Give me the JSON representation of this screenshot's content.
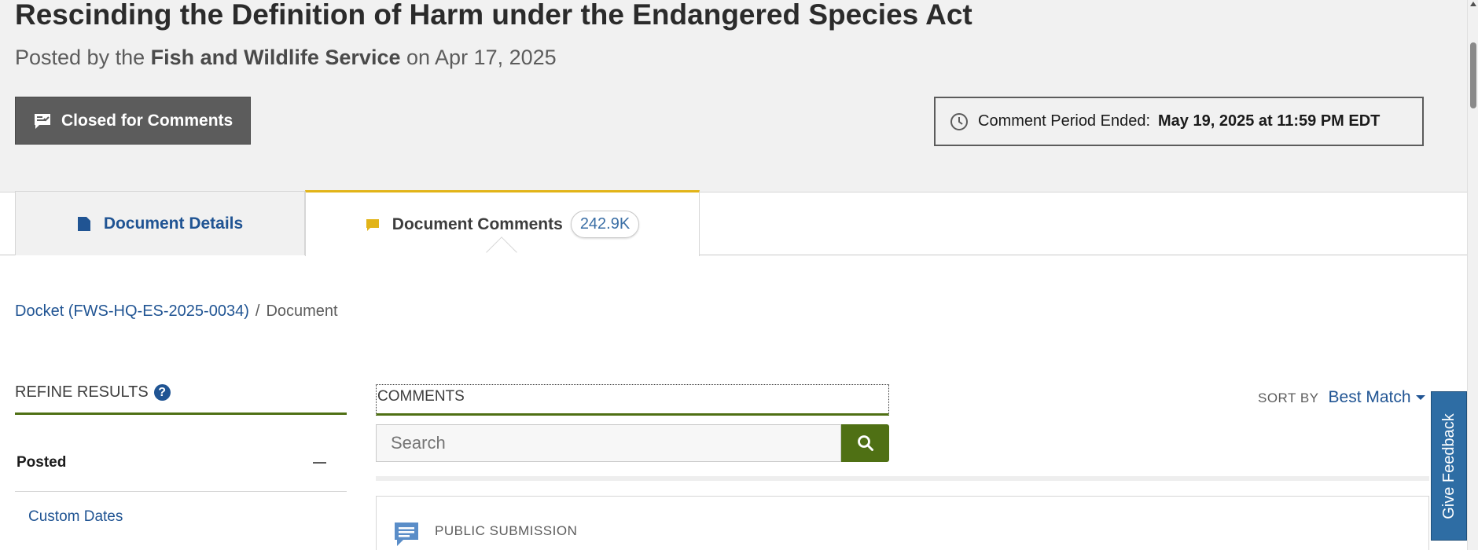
{
  "document": {
    "title": "Rescinding the Definition of Harm under the Endangered Species Act",
    "posted_prefix": "Posted by the",
    "agency": "Fish and Wildlife Service",
    "posted_on": "on Apr 17, 2025"
  },
  "status": {
    "closed_label": "Closed for Comments",
    "period_label": "Comment Period Ended:",
    "period_value": "May 19, 2025 at 11:59 PM EDT"
  },
  "tabs": [
    {
      "label": "Document Details"
    },
    {
      "label": "Document Comments",
      "count": "242.9K"
    }
  ],
  "breadcrumb": {
    "docket": "Docket (FWS-HQ-ES-2025-0034)",
    "separator": "/",
    "current": "Document"
  },
  "refine": {
    "title": "REFINE RESULTS",
    "help": "?",
    "facet_label": "Posted",
    "custom_dates": "Custom Dates"
  },
  "comments": {
    "heading": "COMMENTS",
    "search_placeholder": "Search",
    "sort_label": "SORT BY",
    "sort_value": "Best Match",
    "first_result_type": "PUBLIC SUBMISSION"
  },
  "feedback": {
    "label": "Give Feedback"
  },
  "colors": {
    "accent_green": "#4f7014",
    "link_blue": "#205493",
    "tab_gold": "#e2b418",
    "dark_button": "#5c5c5c"
  },
  "icons": [
    "comment-closed-icon",
    "clock-icon",
    "document-icon",
    "comment-icon",
    "search-icon",
    "help-icon",
    "collapse-icon",
    "chevron-down-icon",
    "submission-icon"
  ]
}
